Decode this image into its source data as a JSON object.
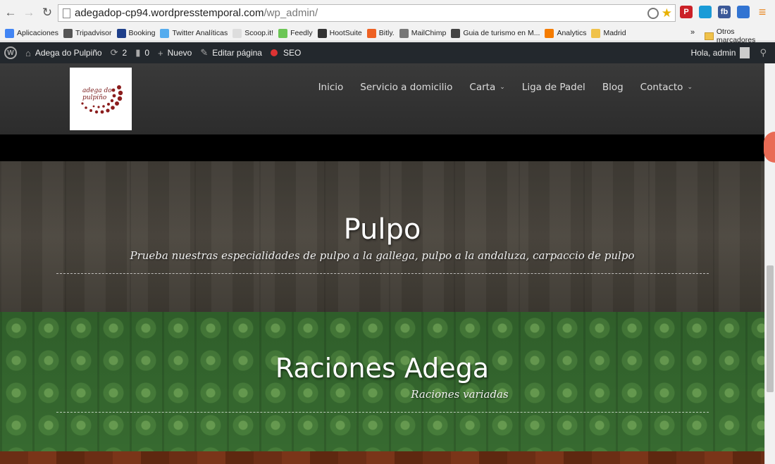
{
  "browser": {
    "url_host": "adegadop-cp94.wordpresstemporal.com",
    "url_path": "/wp_admin/",
    "extensions": [
      {
        "name": "pinterest-icon",
        "label": "P",
        "color": "#cb2027"
      },
      {
        "name": "extension-icon",
        "label": "",
        "color": "#1a9bd7"
      },
      {
        "name": "facebook-icon",
        "label": "fb",
        "color": "#3b5998"
      },
      {
        "name": "delicious-icon",
        "label": "",
        "color": "#3274d2"
      },
      {
        "name": "menu-icon",
        "label": "≡",
        "color": "#f2f2f2"
      }
    ]
  },
  "bookmarks": {
    "items": [
      {
        "label": "Aplicaciones",
        "color": "#4285f4"
      },
      {
        "label": "Tripadvisor",
        "color": "#555555"
      },
      {
        "label": "Booking",
        "color": "#1e3f8a"
      },
      {
        "label": "Twitter Analíticas",
        "color": "#55acee"
      },
      {
        "label": "Scoop.it!",
        "color": "#dddddd"
      },
      {
        "label": "Feedly",
        "color": "#6cc655"
      },
      {
        "label": "HootSuite",
        "color": "#333333"
      },
      {
        "label": "Bitly.",
        "color": "#ee6123"
      },
      {
        "label": "MailChimp",
        "color": "#777777"
      },
      {
        "label": "Guia de turismo en M...",
        "color": "#444444"
      },
      {
        "label": "Analytics",
        "color": "#f57c00"
      },
      {
        "label": "Madrid",
        "color": "#f0c24b"
      }
    ],
    "more": "»",
    "others": "Otros marcadores"
  },
  "adminbar": {
    "site_name": "Adega do Pulpiño",
    "updates": "2",
    "comments": "0",
    "new": "Nuevo",
    "edit": "Editar página",
    "seo": "SEO",
    "greeting": "Hola, admin"
  },
  "site": {
    "logo_text_line1": "adega do",
    "logo_text_line2": "pulpiño",
    "nav": [
      {
        "label": "Inicio",
        "has_caret": false
      },
      {
        "label": "Servicio a domicilio",
        "has_caret": false
      },
      {
        "label": "Carta",
        "has_caret": true
      },
      {
        "label": "Liga de Padel",
        "has_caret": false
      },
      {
        "label": "Blog",
        "has_caret": false
      },
      {
        "label": "Contacto",
        "has_caret": true
      }
    ]
  },
  "sections": {
    "pulpo": {
      "title": "Pulpo",
      "subtitle": "Prueba nuestras especialidades de pulpo a la gallega, pulpo a la andaluza, carpaccio de pulpo"
    },
    "raciones": {
      "title": "Raciones Adega",
      "subtitle": "Raciones variadas"
    }
  }
}
